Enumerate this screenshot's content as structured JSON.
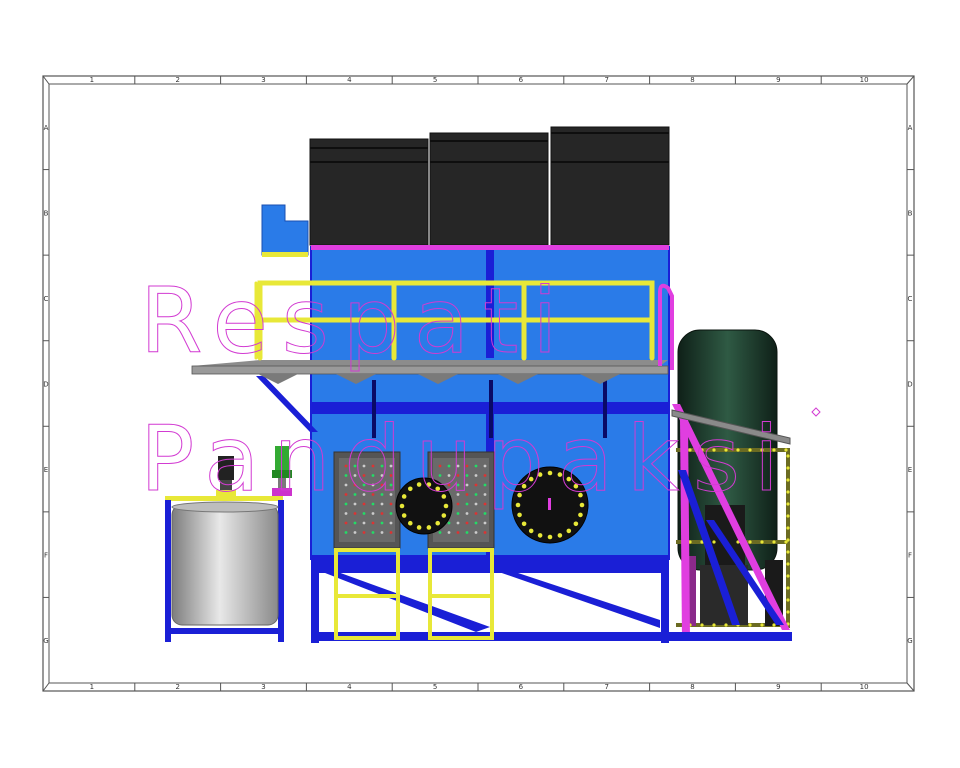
{
  "sheet": {
    "column_labels": [
      "1",
      "2",
      "3",
      "4",
      "5",
      "6",
      "7",
      "8",
      "9",
      "10"
    ],
    "row_labels": [
      "A",
      "B",
      "C",
      "D",
      "E",
      "F",
      "G"
    ]
  },
  "watermark": {
    "line1": "Respati",
    "line2": "Pandupaksi"
  },
  "colors": {
    "frame_blue": "#1a1fd6",
    "tank_blue": "#2a7be8",
    "railing_yellow": "#e8e838",
    "pipe_magenta": "#e03ee0",
    "cover_black": "#262626",
    "vessel_green": "#1f3a2a",
    "steel_grey": "#9a9a9a",
    "watermark_pink": "#d23bd2"
  }
}
